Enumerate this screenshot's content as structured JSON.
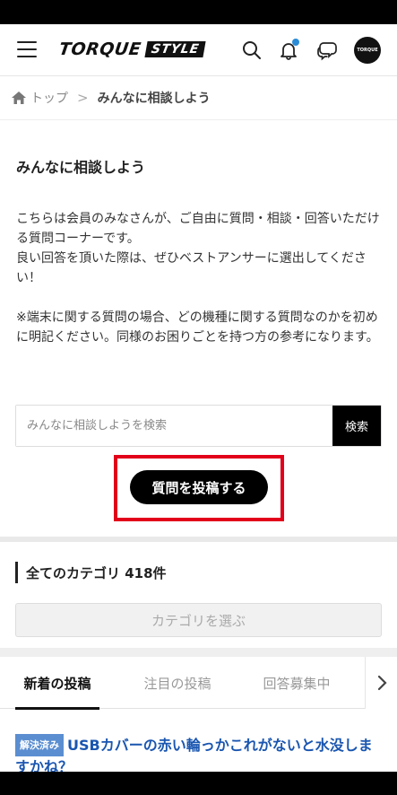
{
  "header": {
    "logo_main": "TORQUE",
    "logo_sub": "STYLE",
    "avatar_text": "TORQUE"
  },
  "breadcrumb": {
    "home": "トップ",
    "separator": ">",
    "current": "みんなに相談しよう"
  },
  "main": {
    "title": "みんなに相談しよう",
    "desc1": "こちらは会員のみなさんが、ご自由に質問・相談・回答いただける質問コーナーです。",
    "desc2": "良い回答を頂いた際は、ぜひベストアンサーに選出してください！",
    "desc3": "※端末に関する質問の場合、どの機種に関する質問なのかを初めに明記ください。同様のお困りごとを持つ方の参考になります。"
  },
  "search": {
    "placeholder": "みんなに相談しようを検索",
    "button": "検索"
  },
  "post_button": "質問を投稿する",
  "category": {
    "title": "全てのカテゴリ 418件",
    "select_label": "カテゴリを選ぶ"
  },
  "tabs": [
    "新着の投稿",
    "注目の投稿",
    "回答募集中"
  ],
  "post": {
    "badge": "解決済み",
    "title": "USBカバーの赤い輪っかこれがないと水没しますかね？"
  },
  "colors": {
    "highlight": "#e2001a",
    "badge": "#5b8ed1",
    "link": "#1a56b0",
    "notification_dot": "#2a8bd6"
  },
  "icons": [
    "menu-icon",
    "search-icon",
    "bell-icon",
    "chat-icon",
    "home-icon",
    "chevron-right-icon"
  ]
}
